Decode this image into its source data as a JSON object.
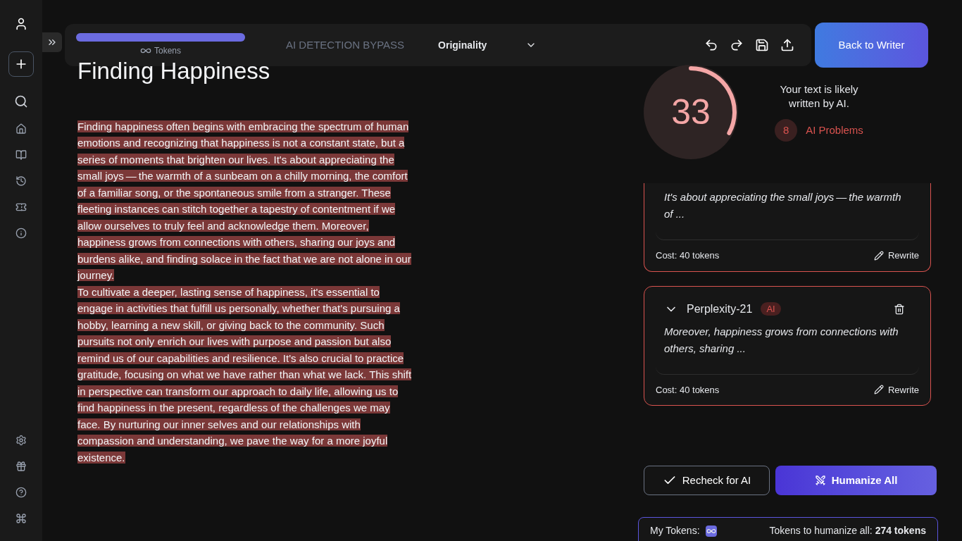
{
  "toolbar": {
    "tokens": {
      "label": "Tokens",
      "level": 1
    },
    "mode": "AI DETECTION BYPASS",
    "detector": {
      "value": "Originality"
    },
    "back_button": "Back to Writer"
  },
  "document": {
    "title": "Finding Happiness",
    "paragraphs": [
      {
        "text": "Finding happiness often begins with embracing the spectrum of human emotions and recognizing that happiness is not a constant state, but a series of moments that brighten our lives. It's about appreciating the small joys — the warmth of a sunbeam on a chilly morning, the comfort of a familiar song, or the spontaneous smile from a stranger. These fleeting instances can stitch together a tapestry of contentment if we allow ourselves to truly feel and acknowledge them. Moreover, happiness grows from connections with others, sharing our joys and burdens alike, and finding solace in the fact that we are not alone in our journey.",
        "flagged": true
      },
      {
        "text": "To cultivate a deeper, lasting sense of happiness, it's essential to engage in activities that fulfill us personally, whether that's pursuing a hobby, learning a new skill, or giving back to the community. Such pursuits not only enrich our lives with purpose and passion but also remind us of our capabilities and resilience. It's also crucial to practice gratitude, focusing on what we have rather than what we lack. This shift in perspective can transform our approach to daily life, allowing us to find happiness in the present, regardless of the challenges we may face. By nurturing our inner selves and our relationships with compassion and understanding, we pave the way for a more joyful existence.",
        "flagged": true
      }
    ]
  },
  "score": {
    "value": "33",
    "verdict": "Your text is likely written by AI.",
    "problems_count": "8",
    "problems_label": "AI Problems"
  },
  "issues": [
    {
      "excerpt": "It's about appreciating the small joys — the warmth of ...",
      "cost": "Cost: 40 tokens",
      "action": "Rewrite",
      "expanded": true
    },
    {
      "title": "Perplexity-21",
      "tag": "AI",
      "excerpt": "Moreover, happiness grows from connections with others, sharing ...",
      "cost": "Cost: 40 tokens",
      "action": "Rewrite",
      "expanded": true
    }
  ],
  "actions": {
    "recheck": "Recheck for AI",
    "humanize": "Humanize All"
  },
  "footer": {
    "my_tokens": "My Tokens:",
    "humanize_cost_label": "Tokens to humanize all:",
    "humanize_cost": "274 tokens"
  }
}
